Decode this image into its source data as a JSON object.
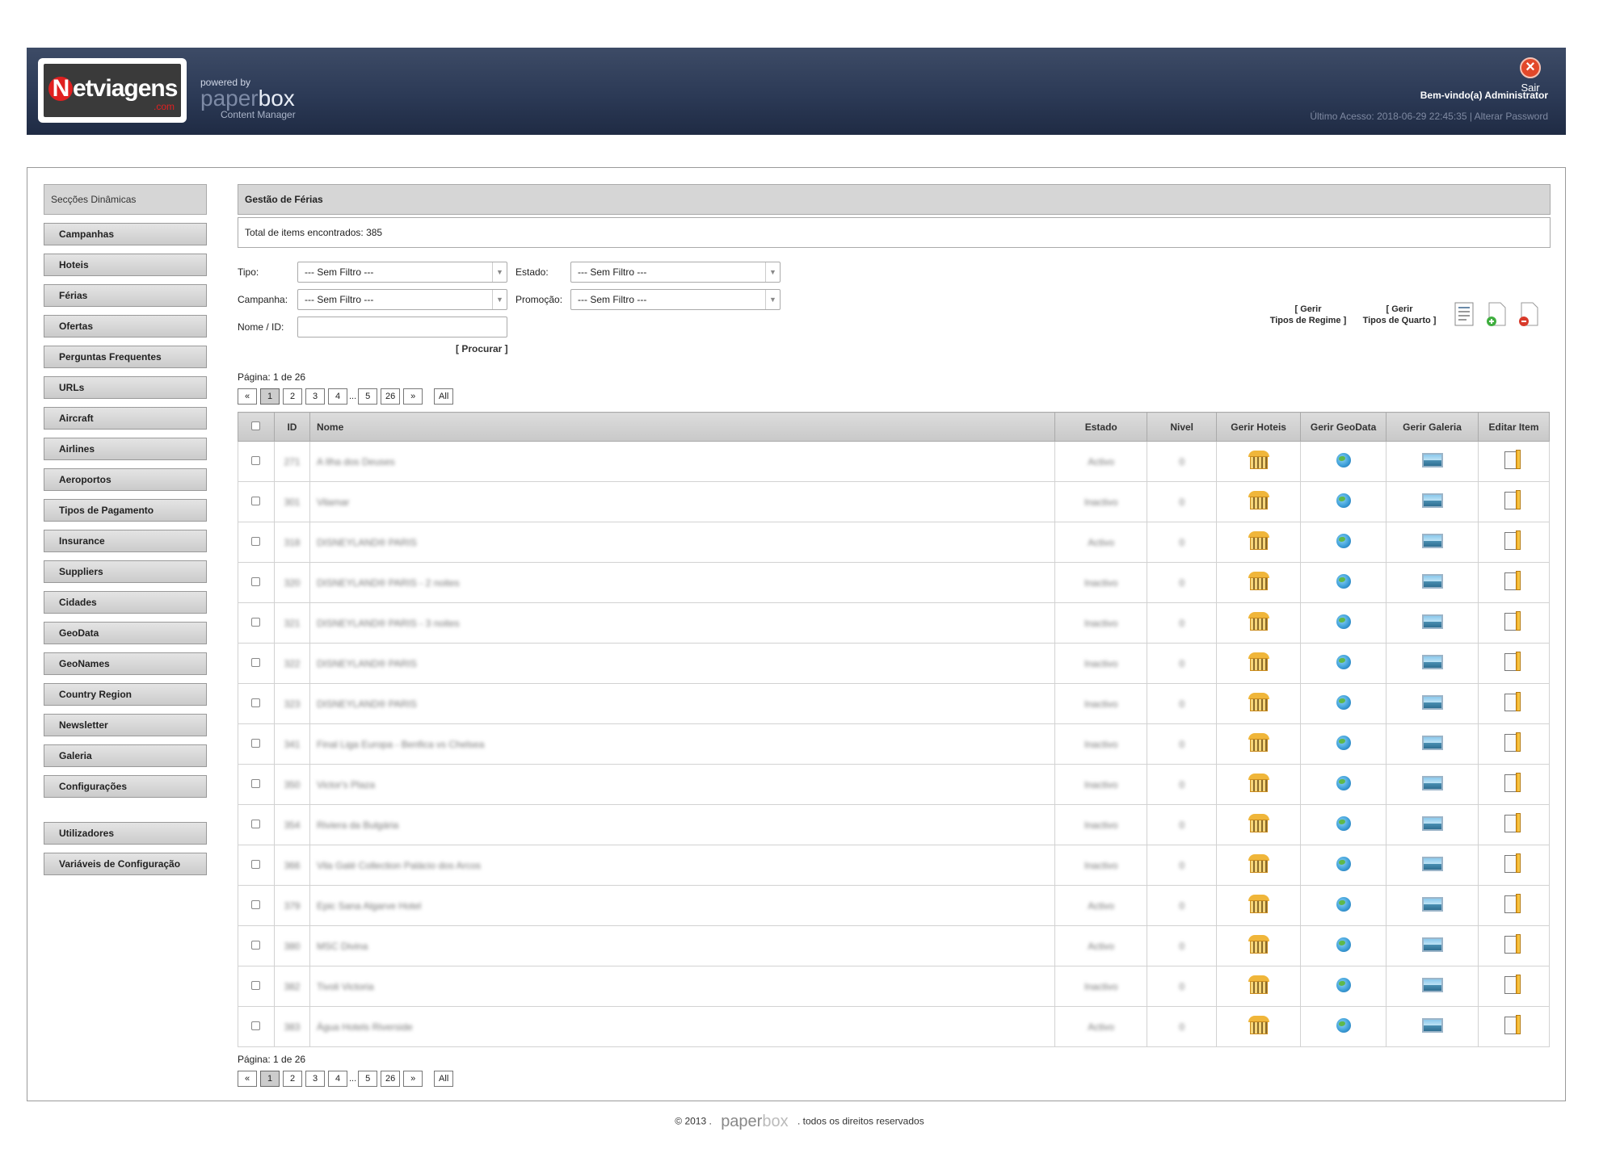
{
  "header": {
    "logo_text": "Netviagens",
    "logo_suffix": ".com",
    "powered_by": "powered by",
    "brand_a": "paper",
    "brand_b": "box",
    "brand_tagline": "Content Manager",
    "exit_label": "Sair",
    "welcome": "Bem-vindo(a)  Administrator",
    "last_access": "Último Acesso: 2018-06-29 22:45:35   |   Alterar Password"
  },
  "sidebar": {
    "title": "Secções Dinâmicas",
    "items": [
      "Campanhas",
      "Hoteis",
      "Férias",
      "Ofertas",
      "Perguntas Frequentes",
      "URLs",
      "Aircraft",
      "Airlines",
      "Aeroportos",
      "Tipos de Pagamento",
      "Insurance",
      "Suppliers",
      "Cidades",
      "GeoData",
      "GeoNames",
      "Country Region",
      "Newsletter",
      "Galeria",
      "Configurações"
    ],
    "extra_items": [
      "Utilizadores",
      "Variáveis de Configuração"
    ]
  },
  "content": {
    "title": "Gestão de Férias",
    "total": "Total de items encontrados: 385",
    "filters": {
      "tipo_label": "Tipo:",
      "tipo_value": "--- Sem Filtro ---",
      "estado_label": "Estado:",
      "estado_value": "--- Sem Filtro ---",
      "campanha_label": "Campanha:",
      "campanha_value": "--- Sem Filtro ---",
      "promocao_label": "Promoção:",
      "promocao_value": "--- Sem Filtro ---",
      "nome_label": "Nome / ID:",
      "nome_value": "",
      "search_label": "[ Procurar ]"
    },
    "tools": {
      "regime_l1": "[ Gerir",
      "regime_l2": "Tipos de Regime ]",
      "quarto_l1": "[ Gerir",
      "quarto_l2": "Tipos de Quarto ]"
    },
    "pagination": {
      "info": "Página: 1 de 26",
      "prev": "«",
      "pages": [
        "1",
        "2",
        "3",
        "4"
      ],
      "dots": "...",
      "tail_pages": [
        "5",
        "26"
      ],
      "next": "»",
      "all": "All"
    },
    "table": {
      "headers": {
        "id": "ID",
        "nome": "Nome",
        "estado": "Estado",
        "nivel": "Nivel",
        "hoteis": "Gerir Hoteis",
        "geodata": "Gerir GeoData",
        "galeria": "Gerir Galeria",
        "editar": "Editar Item"
      },
      "rows": [
        {
          "id": "271",
          "nome": "A Ilha dos Deuses",
          "estado": "Activo",
          "nivel": "0"
        },
        {
          "id": "301",
          "nome": "Vilamar",
          "estado": "Inactivo",
          "nivel": "0"
        },
        {
          "id": "318",
          "nome": "DISNEYLAND® PARIS",
          "estado": "Activo",
          "nivel": "0"
        },
        {
          "id": "320",
          "nome": "DISNEYLAND® PARIS - 2 noites",
          "estado": "Inactivo",
          "nivel": "0"
        },
        {
          "id": "321",
          "nome": "DISNEYLAND® PARIS - 3 noites",
          "estado": "Inactivo",
          "nivel": "0"
        },
        {
          "id": "322",
          "nome": "DISNEYLAND® PARIS",
          "estado": "Inactivo",
          "nivel": "0"
        },
        {
          "id": "323",
          "nome": "DISNEYLAND® PARIS",
          "estado": "Inactivo",
          "nivel": "0"
        },
        {
          "id": "341",
          "nome": "Final Liga Europa - Benfica vs Chelsea",
          "estado": "Inactivo",
          "nivel": "0"
        },
        {
          "id": "350",
          "nome": "Victor's Plaza",
          "estado": "Inactivo",
          "nivel": "0"
        },
        {
          "id": "354",
          "nome": "Riviera da Bulgária",
          "estado": "Inactivo",
          "nivel": "0"
        },
        {
          "id": "366",
          "nome": "Vila Galé Collection Palácio dos Arcos",
          "estado": "Inactivo",
          "nivel": "0"
        },
        {
          "id": "379",
          "nome": "Epic Sana Algarve Hotel",
          "estado": "Activo",
          "nivel": "0"
        },
        {
          "id": "380",
          "nome": "MSC Divina",
          "estado": "Activo",
          "nivel": "0"
        },
        {
          "id": "382",
          "nome": "Tivoli Victoria",
          "estado": "Inactivo",
          "nivel": "0"
        },
        {
          "id": "383",
          "nome": "Água Hotels Riverside",
          "estado": "Activo",
          "nivel": "0"
        }
      ]
    }
  },
  "footer": {
    "copyright": "© 2013",
    "sep": ".",
    "brand_a": "paper",
    "brand_b": "box",
    "rights": "todos os direitos reservados"
  }
}
